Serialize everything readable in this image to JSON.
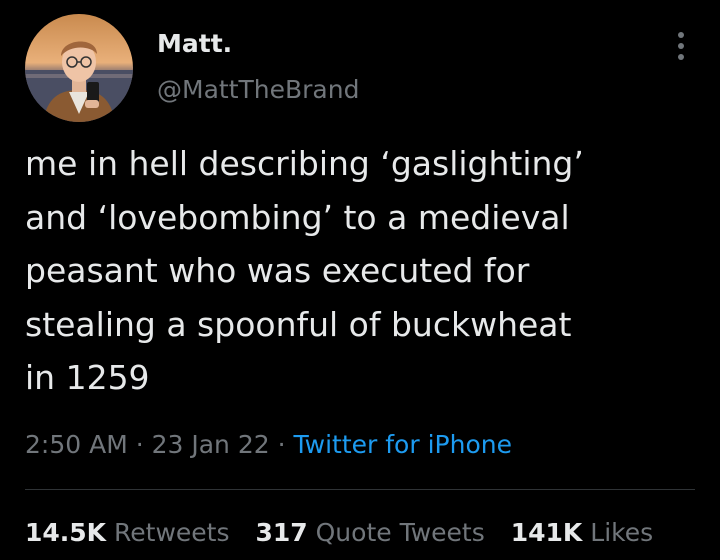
{
  "tweet": {
    "author": {
      "display_name": "Matt.",
      "handle": "@MattTheBrand",
      "avatar_icon": "user-avatar-photo"
    },
    "more_icon": "more-vertical-icon",
    "text": "me in hell describing ‘gaslighting’\nand ‘lovebombing’ to a medieval\npeasant who was executed for\nstealing a spoonful of buckwheat\nin 1259",
    "time": "2:50 AM",
    "separator": " · ",
    "date": "23 Jan 22",
    "source": "Twitter for iPhone",
    "stats": {
      "retweets": {
        "count": "14.5K",
        "label": "Retweets"
      },
      "quote_tweets": {
        "count": "317",
        "label": "Quote Tweets"
      },
      "likes": {
        "count": "141K",
        "label": "Likes"
      }
    }
  },
  "colors": {
    "background": "#000000",
    "primary_text": "#e7e9ea",
    "secondary_text": "#71767b",
    "link": "#1d9bf0",
    "divider": "#2f3336"
  }
}
